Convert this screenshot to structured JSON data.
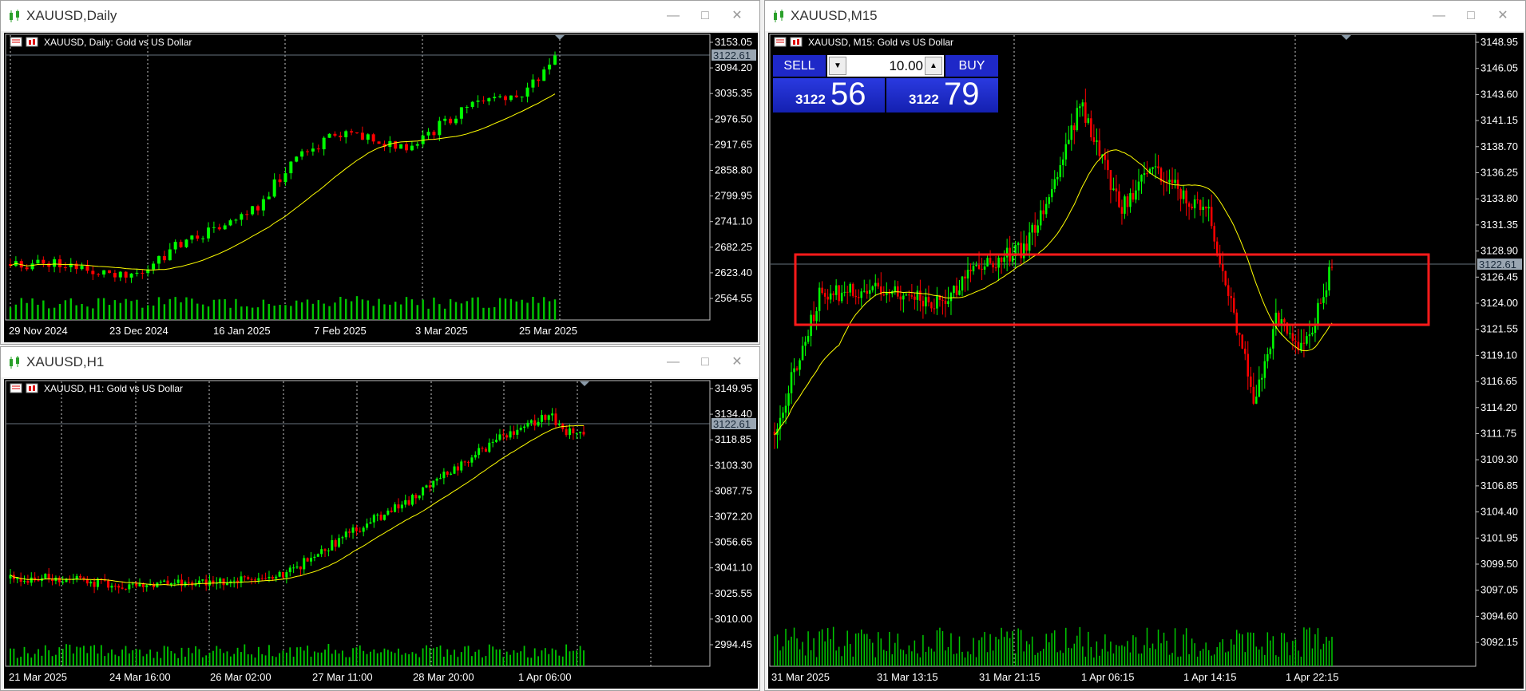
{
  "windows": [
    {
      "id": "daily",
      "title": "XAUUSD,Daily",
      "header": "XAUUSD, Daily:  Gold vs US Dollar",
      "current_price": "3122.61",
      "price_labels": [
        "3153.05",
        "3094.20",
        "3035.35",
        "2976.50",
        "2917.65",
        "2858.80",
        "2799.95",
        "2741.10",
        "2682.25",
        "2623.40",
        "2564.55"
      ],
      "time_labels": [
        "29 Nov 2024",
        "23 Dec 2024",
        "16 Jan 2025",
        "7 Feb 2025",
        "3 Mar 2025",
        "25 Mar 2025"
      ]
    },
    {
      "id": "h1",
      "title": "XAUUSD,H1",
      "header": "XAUUSD, H1:  Gold vs US Dollar",
      "current_price": "3122.61",
      "price_labels": [
        "3149.95",
        "3134.40",
        "3118.85",
        "3103.30",
        "3087.75",
        "3072.20",
        "3056.65",
        "3041.10",
        "3025.55",
        "3010.00",
        "2994.45"
      ],
      "time_labels": [
        "21 Mar 2025",
        "24 Mar 16:00",
        "26 Mar 02:00",
        "27 Mar 11:00",
        "28 Mar 20:00",
        "1 Apr 06:00"
      ]
    },
    {
      "id": "m15",
      "title": "XAUUSD,M15",
      "header": "XAUUSD, M15:  Gold vs US Dollar",
      "current_price": "3122.61",
      "price_labels": [
        "3148.95",
        "3146.05",
        "3143.60",
        "3141.15",
        "3138.70",
        "3136.25",
        "3133.80",
        "3131.35",
        "3128.90",
        "3126.45",
        "3124.00",
        "3121.55",
        "3119.10",
        "3116.65",
        "3114.20",
        "3111.75",
        "3109.30",
        "3106.85",
        "3104.40",
        "3101.95",
        "3099.50",
        "3097.05",
        "3094.60",
        "3092.15"
      ],
      "time_labels": [
        "31 Mar 2025",
        "31 Mar 13:15",
        "31 Mar 21:15",
        "1 Apr 06:15",
        "1 Apr 14:15",
        "1 Apr 22:15"
      ]
    }
  ],
  "trade_panel": {
    "sell_label": "SELL",
    "buy_label": "BUY",
    "lot": "10.00",
    "sell_price_small": "3122",
    "sell_price_big": "56",
    "buy_price_small": "3122",
    "buy_price_big": "79"
  },
  "colors": {
    "bull": "#00ff00",
    "bear": "#ff0000",
    "ma": "#ffff00",
    "volume": "#00c800",
    "highlight_box": "#ff1a1a"
  }
}
